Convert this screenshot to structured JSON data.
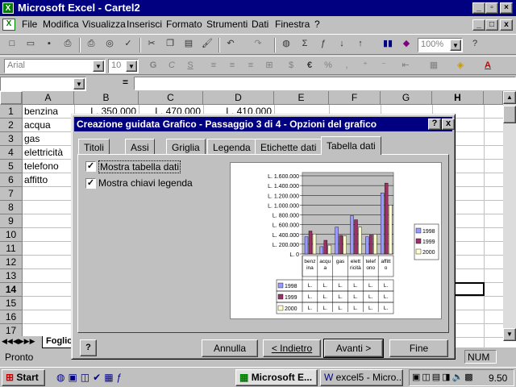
{
  "app": {
    "title": "Microsoft Excel - Cartel2",
    "icon": "excel-icon"
  },
  "doc_window_buttons": [
    "_",
    "□",
    "x"
  ],
  "menu": [
    "File",
    "Modifica",
    "Visualizza",
    "Inserisci",
    "Formato",
    "Strumenti",
    "Dati",
    "Finestra",
    "?"
  ],
  "toolbar": {
    "zoom": "100%"
  },
  "format_bar": {
    "font": "Arial",
    "size": "10",
    "bold": "G",
    "italic": "C",
    "underline": "S",
    "currency": "€",
    "percent": "%"
  },
  "formula_bar": {
    "equals": "="
  },
  "columns": [
    "A",
    "B",
    "C",
    "D",
    "E",
    "F",
    "G",
    "H"
  ],
  "rows": [
    "1",
    "2",
    "3",
    "4",
    "5",
    "6",
    "7",
    "8",
    "9",
    "10",
    "11",
    "12",
    "13",
    "14",
    "15",
    "16",
    "17"
  ],
  "cells": {
    "a": [
      "benzina",
      "acqua",
      "gas",
      "elettricità",
      "telefono",
      "affitto"
    ],
    "b1": "L. 350.000",
    "c1": "L. 470.000",
    "d1": "L. 410.000"
  },
  "sheet_tab": "Foglio",
  "status": {
    "left": "Pronto",
    "right": "NUM"
  },
  "dialog": {
    "title": "Creazione guidata Grafico - Passaggio 3 di 4 - Opzioni del grafico",
    "help_glyph": "?",
    "close_glyph": "x",
    "tabs": [
      "Titoli",
      "Assi",
      "Griglia",
      "Legenda",
      "Etichette dati",
      "Tabella dati"
    ],
    "active_tab": "Tabella dati",
    "option1": "Mostra tabella dati",
    "option2": "Mostra chiavi legenda",
    "buttons": {
      "cancel": "Annulla",
      "back": "< Indietro",
      "next": "Avanti >",
      "finish": "Fine"
    }
  },
  "chart_data": {
    "type": "bar",
    "categories": [
      "benzina",
      "acqua",
      "gas",
      "elettricità",
      "telefono",
      "affitto"
    ],
    "series": [
      {
        "name": "1998",
        "values": [
          350000,
          150000,
          550000,
          780000,
          350000,
          1250000
        ],
        "color": "#9999ff"
      },
      {
        "name": "1999",
        "values": [
          470000,
          280000,
          380000,
          700000,
          400000,
          1450000
        ],
        "color": "#993366"
      },
      {
        "name": "2000",
        "values": [
          410000,
          180000,
          370000,
          550000,
          400000,
          1000000
        ],
        "color": "#ffffcc"
      }
    ],
    "ylim": [
      0,
      1600000
    ],
    "y_ticks": [
      "L. 1.600.000",
      "L. 1.400.000",
      "L. 1.200.000",
      "L. 1.000.000",
      "L. 800.000",
      "L. 600.000",
      "L. 400.000",
      "L. 200.000",
      "L. 0"
    ],
    "x_tick_labels": [
      "benz ina",
      "acqu a",
      "gas",
      "elett ricità",
      "telef ono",
      "affitt o"
    ],
    "table_cell": "L.",
    "legend_placement": "right",
    "grid": true
  },
  "taskbar": {
    "start": "Start",
    "excel_task": "Microsoft E...",
    "word_task": "excel5 - Micro...",
    "clock": "9.50"
  }
}
